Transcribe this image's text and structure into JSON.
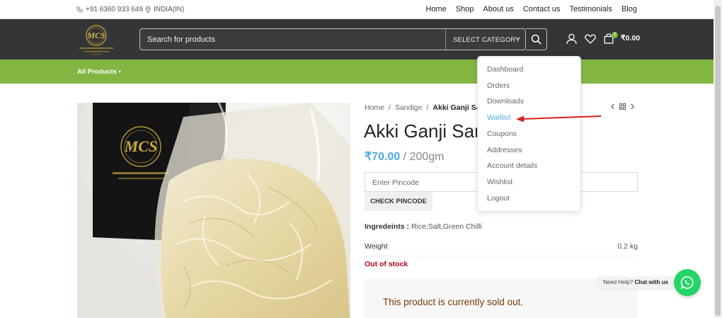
{
  "topbar": {
    "phone": "+91 6360 933 649",
    "region": "INDIA(IN)",
    "nav": [
      "Home",
      "Shop",
      "About us",
      "Contact us",
      "Testimonials",
      "Blog"
    ]
  },
  "header": {
    "logo_text": "MCS",
    "search_placeholder": "Search for products",
    "category_label": "SELECT CATEGORY",
    "cart_total": "₹0.00",
    "cart_count": "0"
  },
  "greenbar": {
    "all_products": "All Products"
  },
  "product": {
    "breadcrumb": [
      "Home",
      "Sandige",
      "Akki Ganji Sandige"
    ],
    "title": "Akki Ganji Sandige",
    "price": "₹70.00",
    "price_unit": "/ 200gm",
    "pincode_placeholder": "Enter Pincode",
    "check_label": "CHECK PINCODE",
    "ingredients_label": "Ingredeints :",
    "ingredients": "Rice,Salt,Green Chilli",
    "weight_label": "Weight",
    "weight_value": "0.2 kg",
    "stock_status": "Out of stock",
    "sold_out_msg": "This product is currently sold out."
  },
  "account_menu": {
    "items": [
      "Dashboard",
      "Orders",
      "Downloads",
      "Waitlist",
      "Coupons",
      "Addresses",
      "Account details",
      "Wishlist",
      "Logout"
    ],
    "highlighted": "Waitlist"
  },
  "chat": {
    "prompt": "Need Help?",
    "action": "Chat with us"
  },
  "colors": {
    "header_bg": "#343536",
    "green_bar": "#82b541",
    "price_blue": "#4faad8",
    "out_of_stock": "#b5001f",
    "whatsapp": "#25d366",
    "annotation_arrow": "#d81f1f"
  }
}
